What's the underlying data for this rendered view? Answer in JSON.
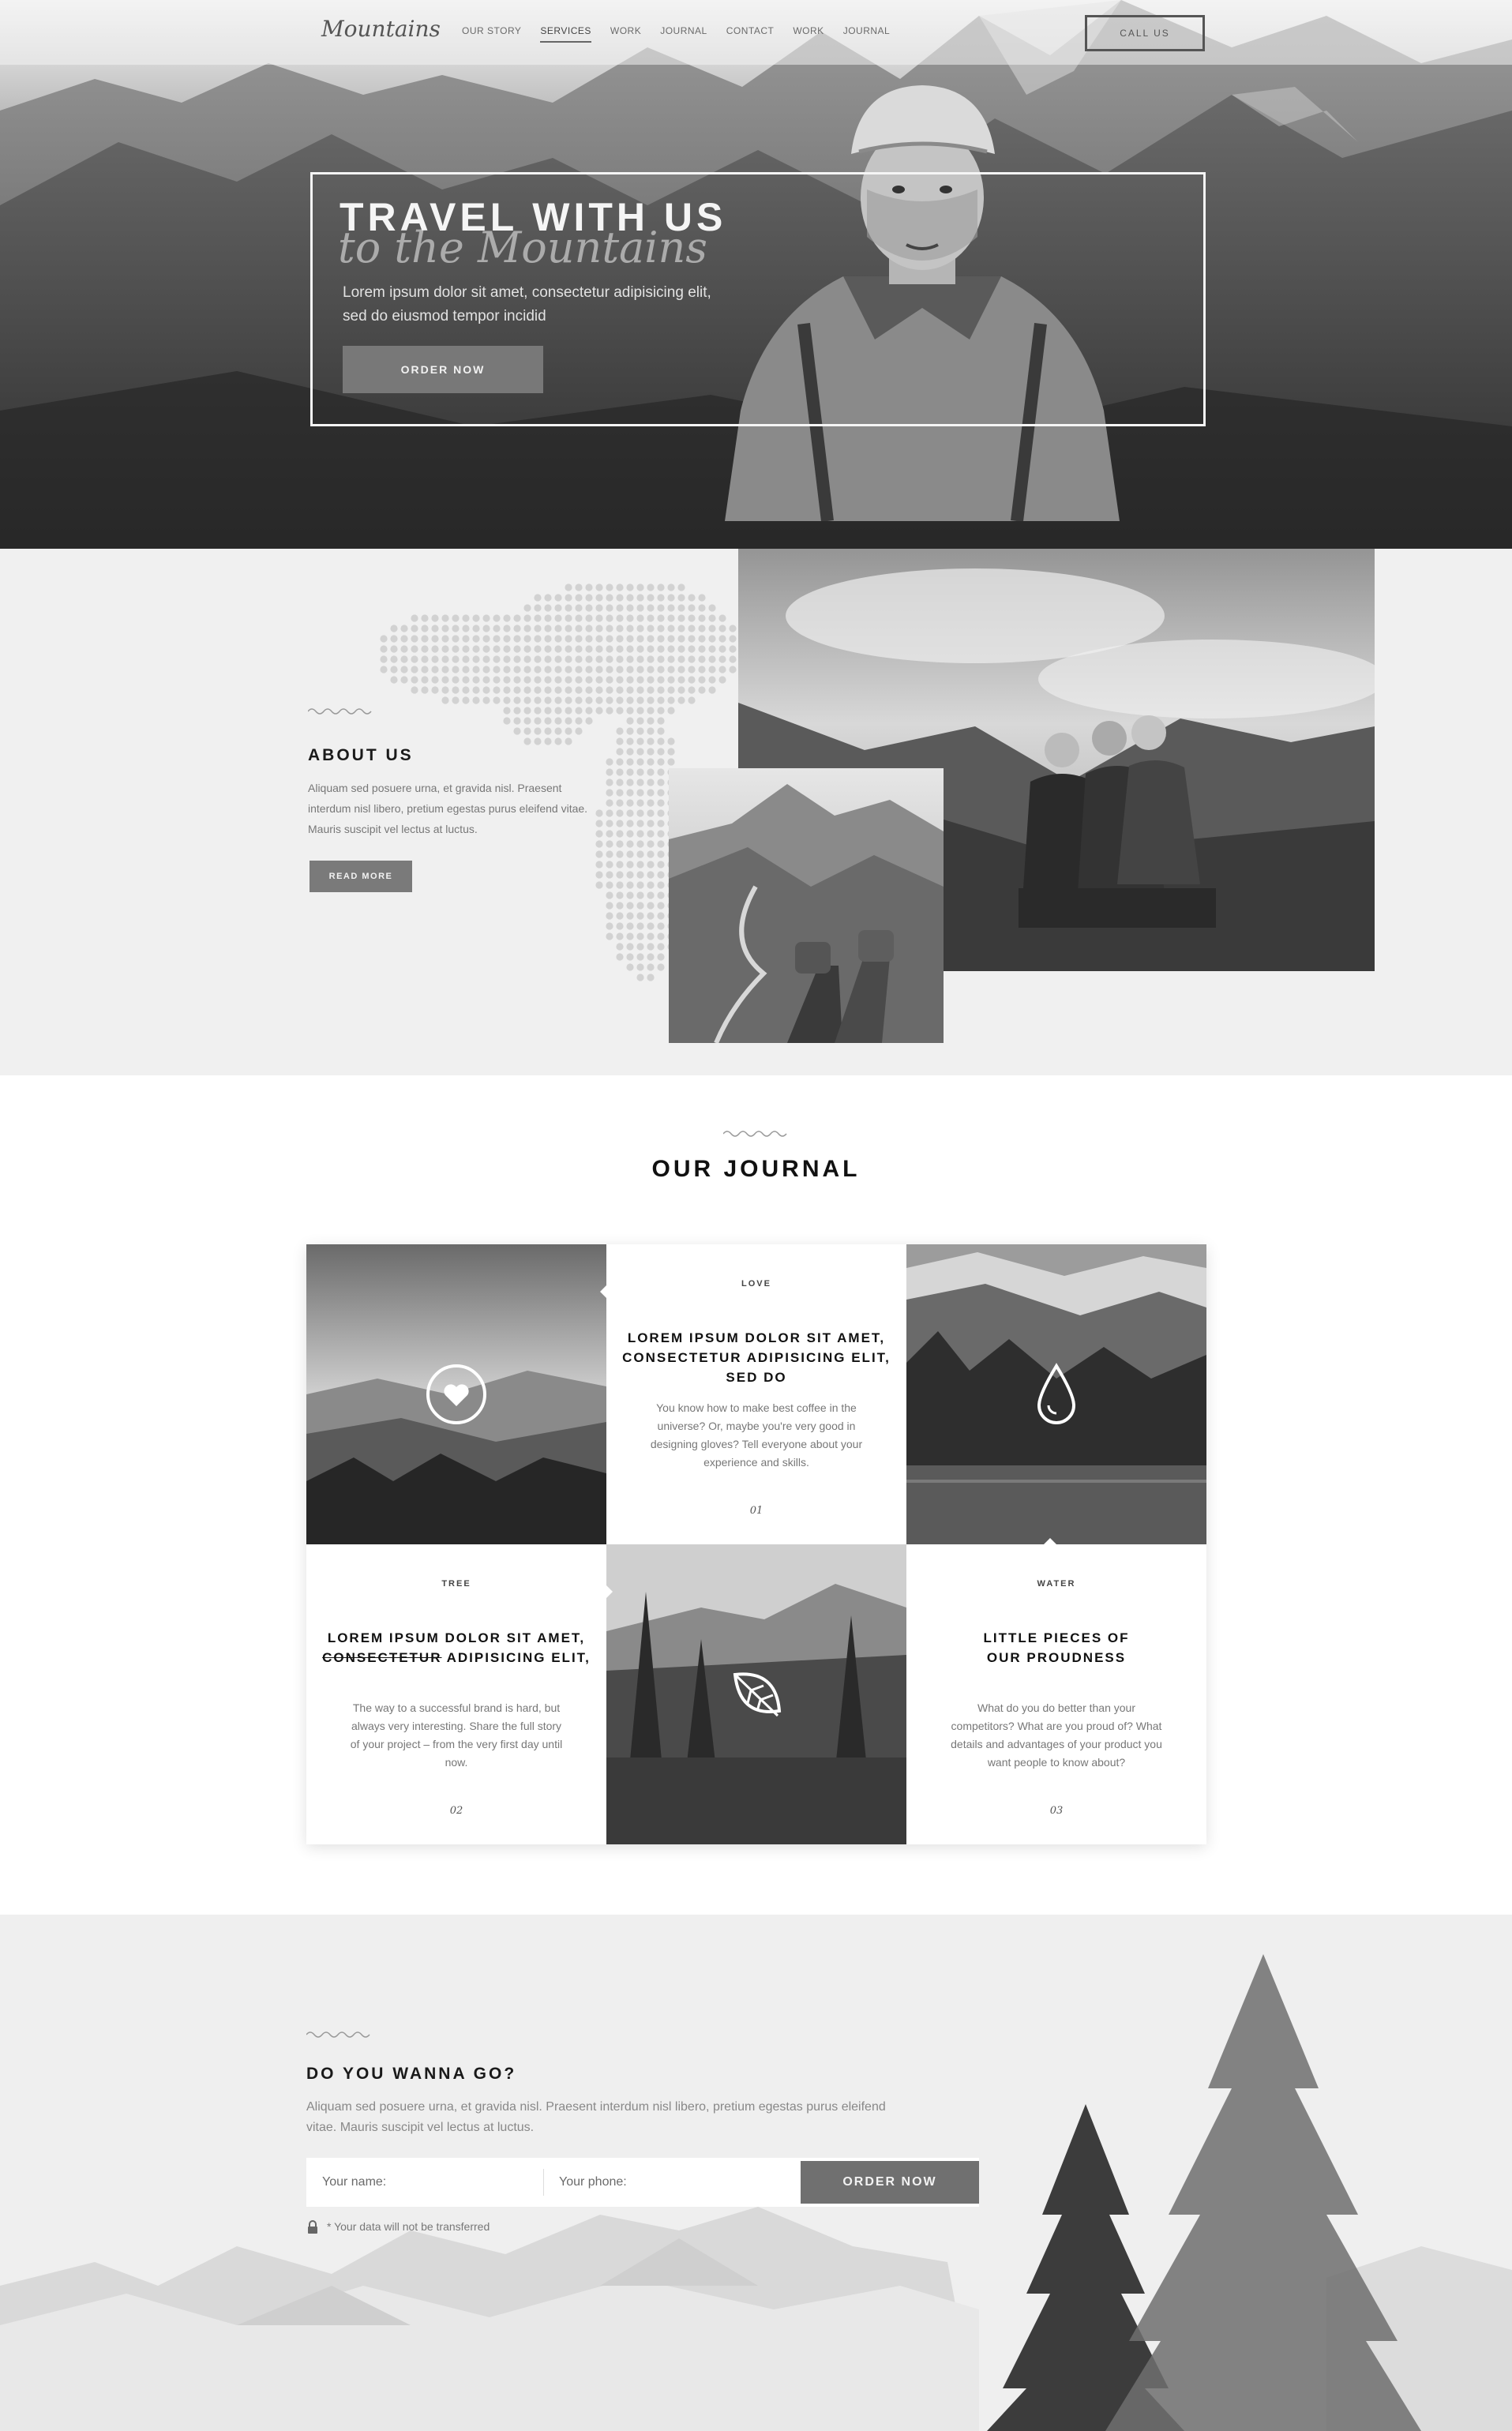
{
  "nav": {
    "logo": "Mountains",
    "links": [
      "OUR STORY",
      "SERVICES",
      "WORK",
      "JOURNAL",
      "CONTACT",
      "WORK",
      "JOURNAL"
    ],
    "active": "SERVICES",
    "cta": "CALL US"
  },
  "hero": {
    "title": "TRAVEL WITH US",
    "script": "to the Mountains",
    "text": "Lorem ipsum dolor sit amet, consectetur adipisicing elit, sed do eiusmod tempor incidid",
    "button": "ORDER NOW"
  },
  "about": {
    "title": "ABOUT US",
    "text": "Aliquam sed posuere urna, et gravida nisl. Praesent interdum nisl libero, pretium egestas purus eleifend vitae. Mauris suscipit vel lectus at luctus.",
    "button": "READ MORE"
  },
  "journal": {
    "title": "OUR JOURNAL",
    "cards": [
      {
        "tag": "LOVE",
        "title": "LOREM IPSUM DOLOR SIT AMET, CONSECTETUR ADIPISICING ELIT, SED DO",
        "body": "You know how to make best coffee in the universe? Or, maybe you're very good in designing gloves? Tell everyone about your experience and skills.",
        "num": "01",
        "icon": "heart-icon"
      },
      {
        "tag": "TREE",
        "title_a": "LOREM IPSUM DOLOR SIT AMET, ",
        "title_strike": "CONSECTETUR",
        "title_b": " ADIPISICING ELIT,",
        "body": "The way to a successful brand is hard, but always very interesting. Share the full story of your project – from the very first day until now.",
        "num": "02",
        "icon": "leaf-icon"
      },
      {
        "tag": "WATER",
        "title": "LITTLE PIECES OF OUR PROUDNESS",
        "body": "What do you do better than your competitors? What are you proud of? What details and advantages of your product you want people to know about?",
        "num": "03",
        "icon": "water-drop-icon"
      }
    ]
  },
  "cta": {
    "title": "DO YOU WANNA GO?",
    "text": "Aliquam sed posuere urna, et gravida nisl. Praesent interdum nisl libero, pretium egestas purus eleifend vitae. Mauris suscipit vel lectus at luctus.",
    "name_placeholder": "Your name:",
    "phone_placeholder": "Your phone:",
    "button": "ORDER NOW",
    "note": "* Your data will not be transferred"
  }
}
